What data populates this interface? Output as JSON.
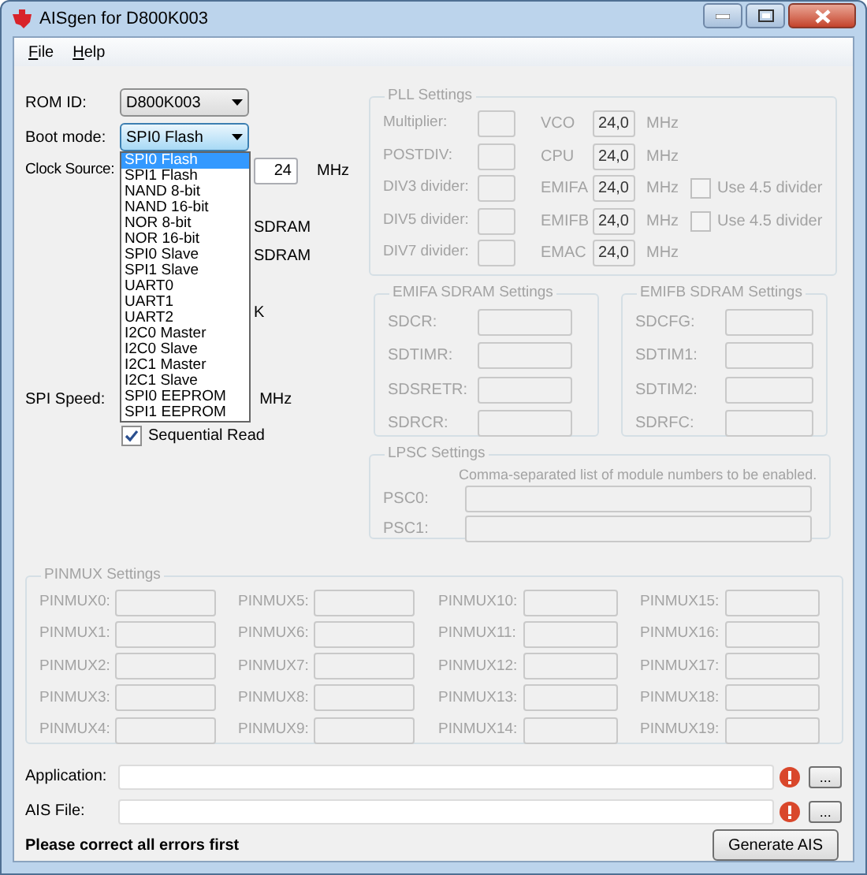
{
  "window": {
    "title": "AISgen for D800K003"
  },
  "menu": [
    {
      "label": "File"
    },
    {
      "label": "Help"
    }
  ],
  "rom_id": {
    "label": "ROM ID:",
    "value": "D800K003"
  },
  "boot_mode": {
    "label": "Boot mode:",
    "value": "SPI0 Flash",
    "expanded": true,
    "options": [
      {
        "label": "SPI0 Flash",
        "selected": true
      },
      {
        "label": "SPI1 Flash",
        "selected": false
      },
      {
        "label": "NAND 8-bit",
        "selected": false
      },
      {
        "label": "NAND 16-bit",
        "selected": false
      },
      {
        "label": "NOR 8-bit",
        "selected": false
      },
      {
        "label": "NOR 16-bit",
        "selected": false
      },
      {
        "label": "SPI0 Slave",
        "selected": false
      },
      {
        "label": "SPI1 Slave",
        "selected": false
      },
      {
        "label": "UART0",
        "selected": false
      },
      {
        "label": "UART1",
        "selected": false
      },
      {
        "label": "UART2",
        "selected": false
      },
      {
        "label": "I2C0 Master",
        "selected": false
      },
      {
        "label": "I2C0 Slave",
        "selected": false
      },
      {
        "label": "I2C1 Master",
        "selected": false
      },
      {
        "label": "I2C1 Slave",
        "selected": false
      },
      {
        "label": "SPI0 EEPROM",
        "selected": false
      },
      {
        "label": "SPI1 EEPROM",
        "selected": false
      }
    ]
  },
  "clock_source": {
    "label": "Clock Source:",
    "value": "24",
    "unit": "MHz"
  },
  "partial_texts": [
    "SDRAM",
    "SDRAM",
    "K"
  ],
  "spi_speed": {
    "label": "SPI Speed:",
    "unit": "MHz"
  },
  "sequential_read": {
    "label": "Sequential Read",
    "checked": true
  },
  "pll": {
    "title": "PLL Settings",
    "disabled": true,
    "dividers": [
      "Multiplier:",
      "POSTDIV:",
      "DIV3 divider:",
      "DIV5 divider:",
      "DIV7 divider:"
    ],
    "clocks": [
      {
        "label": "VCO",
        "value": "24,0",
        "unit": "MHz"
      },
      {
        "label": "CPU",
        "value": "24,0",
        "unit": "MHz"
      },
      {
        "label": "EMIFA",
        "value": "24,0",
        "unit": "MHz",
        "option": {
          "label": "Use 4.5 divider",
          "checked": false
        }
      },
      {
        "label": "EMIFB",
        "value": "24,0",
        "unit": "MHz",
        "option": {
          "label": "Use 4.5 divider",
          "checked": false
        }
      },
      {
        "label": "EMAC",
        "value": "24,0",
        "unit": "MHz"
      }
    ]
  },
  "emifa": {
    "title": "EMIFA SDRAM Settings",
    "disabled": true,
    "fields": [
      "SDCR:",
      "SDTIMR:",
      "SDSRETR:",
      "SDRCR:"
    ]
  },
  "emifb": {
    "title": "EMIFB SDRAM Settings",
    "disabled": true,
    "fields": [
      "SDCFG:",
      "SDTIM1:",
      "SDTIM2:",
      "SDRFC:"
    ]
  },
  "lpsc": {
    "title": "LPSC Settings",
    "disabled": true,
    "note": "Comma-separated list of module numbers to be enabled.",
    "fields": [
      "PSC0:",
      "PSC1:"
    ]
  },
  "pinmux": {
    "title": "PINMUX Settings",
    "disabled": true,
    "fields": [
      "PINMUX0:",
      "PINMUX1:",
      "PINMUX2:",
      "PINMUX3:",
      "PINMUX4:",
      "PINMUX5:",
      "PINMUX6:",
      "PINMUX7:",
      "PINMUX8:",
      "PINMUX9:",
      "PINMUX10:",
      "PINMUX11:",
      "PINMUX12:",
      "PINMUX13:",
      "PINMUX14:",
      "PINMUX15:",
      "PINMUX16:",
      "PINMUX17:",
      "PINMUX18:",
      "PINMUX19:"
    ]
  },
  "files": [
    {
      "label": "Application:",
      "error": true,
      "browse": "..."
    },
    {
      "label": "AIS File:",
      "error": true,
      "browse": "..."
    }
  ],
  "status": "Please correct all errors first",
  "generate_button": "Generate AIS"
}
